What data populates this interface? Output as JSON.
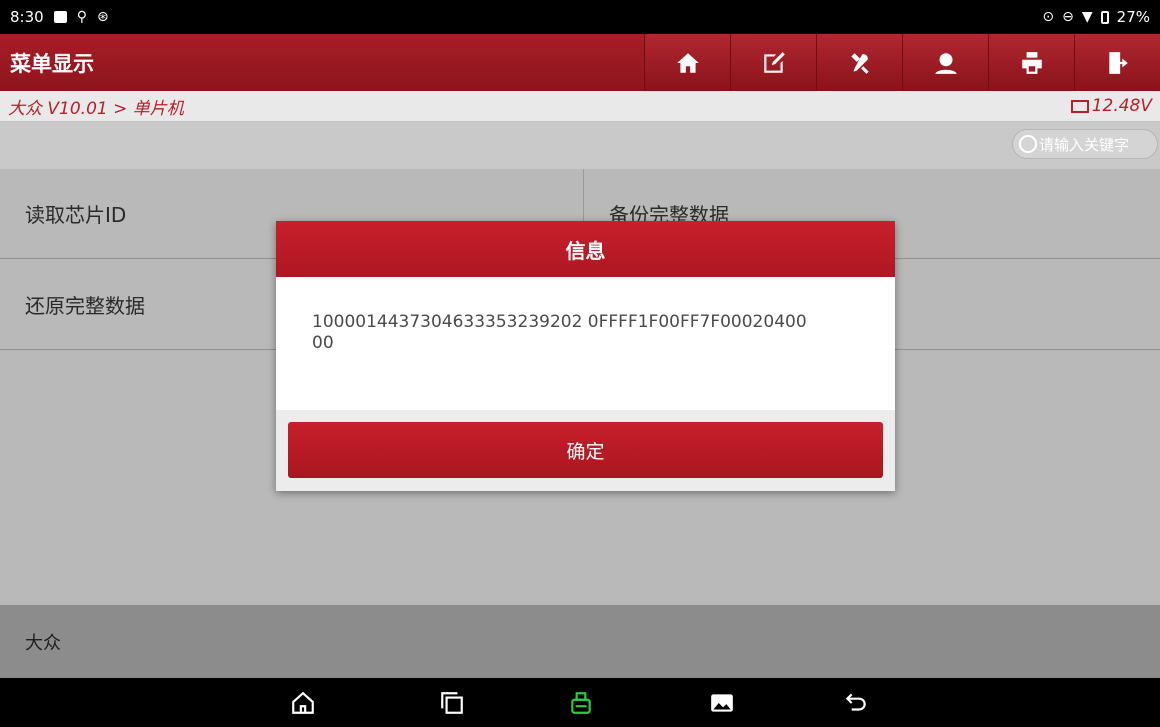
{
  "status_bar": {
    "time": "8:30",
    "battery": "27%",
    "left_icons": [
      "image-icon",
      "usb-icon",
      "bluetooth-icon"
    ],
    "right_icons": [
      "location-icon",
      "dnd-icon",
      "wifi-icon",
      "battery-icon"
    ]
  },
  "header": {
    "title": "菜单显示",
    "toolbar": [
      "home-icon",
      "edit-icon",
      "tools-icon",
      "user-icon",
      "print-icon",
      "exit-icon"
    ]
  },
  "breadcrumb": {
    "path": "大众 V10.01 > 单片机",
    "voltage": "12.48V"
  },
  "search": {
    "placeholder": "请输入关键字"
  },
  "menu": {
    "items": [
      {
        "label": "读取芯片ID"
      },
      {
        "label": "备份完整数据"
      },
      {
        "label": "还原完整数据"
      },
      {
        "label": ""
      }
    ]
  },
  "footer": {
    "label": "大众"
  },
  "dialog": {
    "title": "信息",
    "message": "1000014437304633353239202 0FFFF1F00FF7F0002040000",
    "message_line1": "100001443730463335323920 20FFFF1F00FF7F00020400",
    "ok_label": "确定"
  },
  "colors": {
    "brand_red": "#a71e27",
    "dialog_red": "#c81f2b",
    "crumb_red": "#b81f2b",
    "vci_green": "#2ecc40"
  },
  "nav_bar": [
    "home-icon",
    "recents-icon",
    "vci-icon",
    "gallery-icon",
    "back-icon"
  ]
}
